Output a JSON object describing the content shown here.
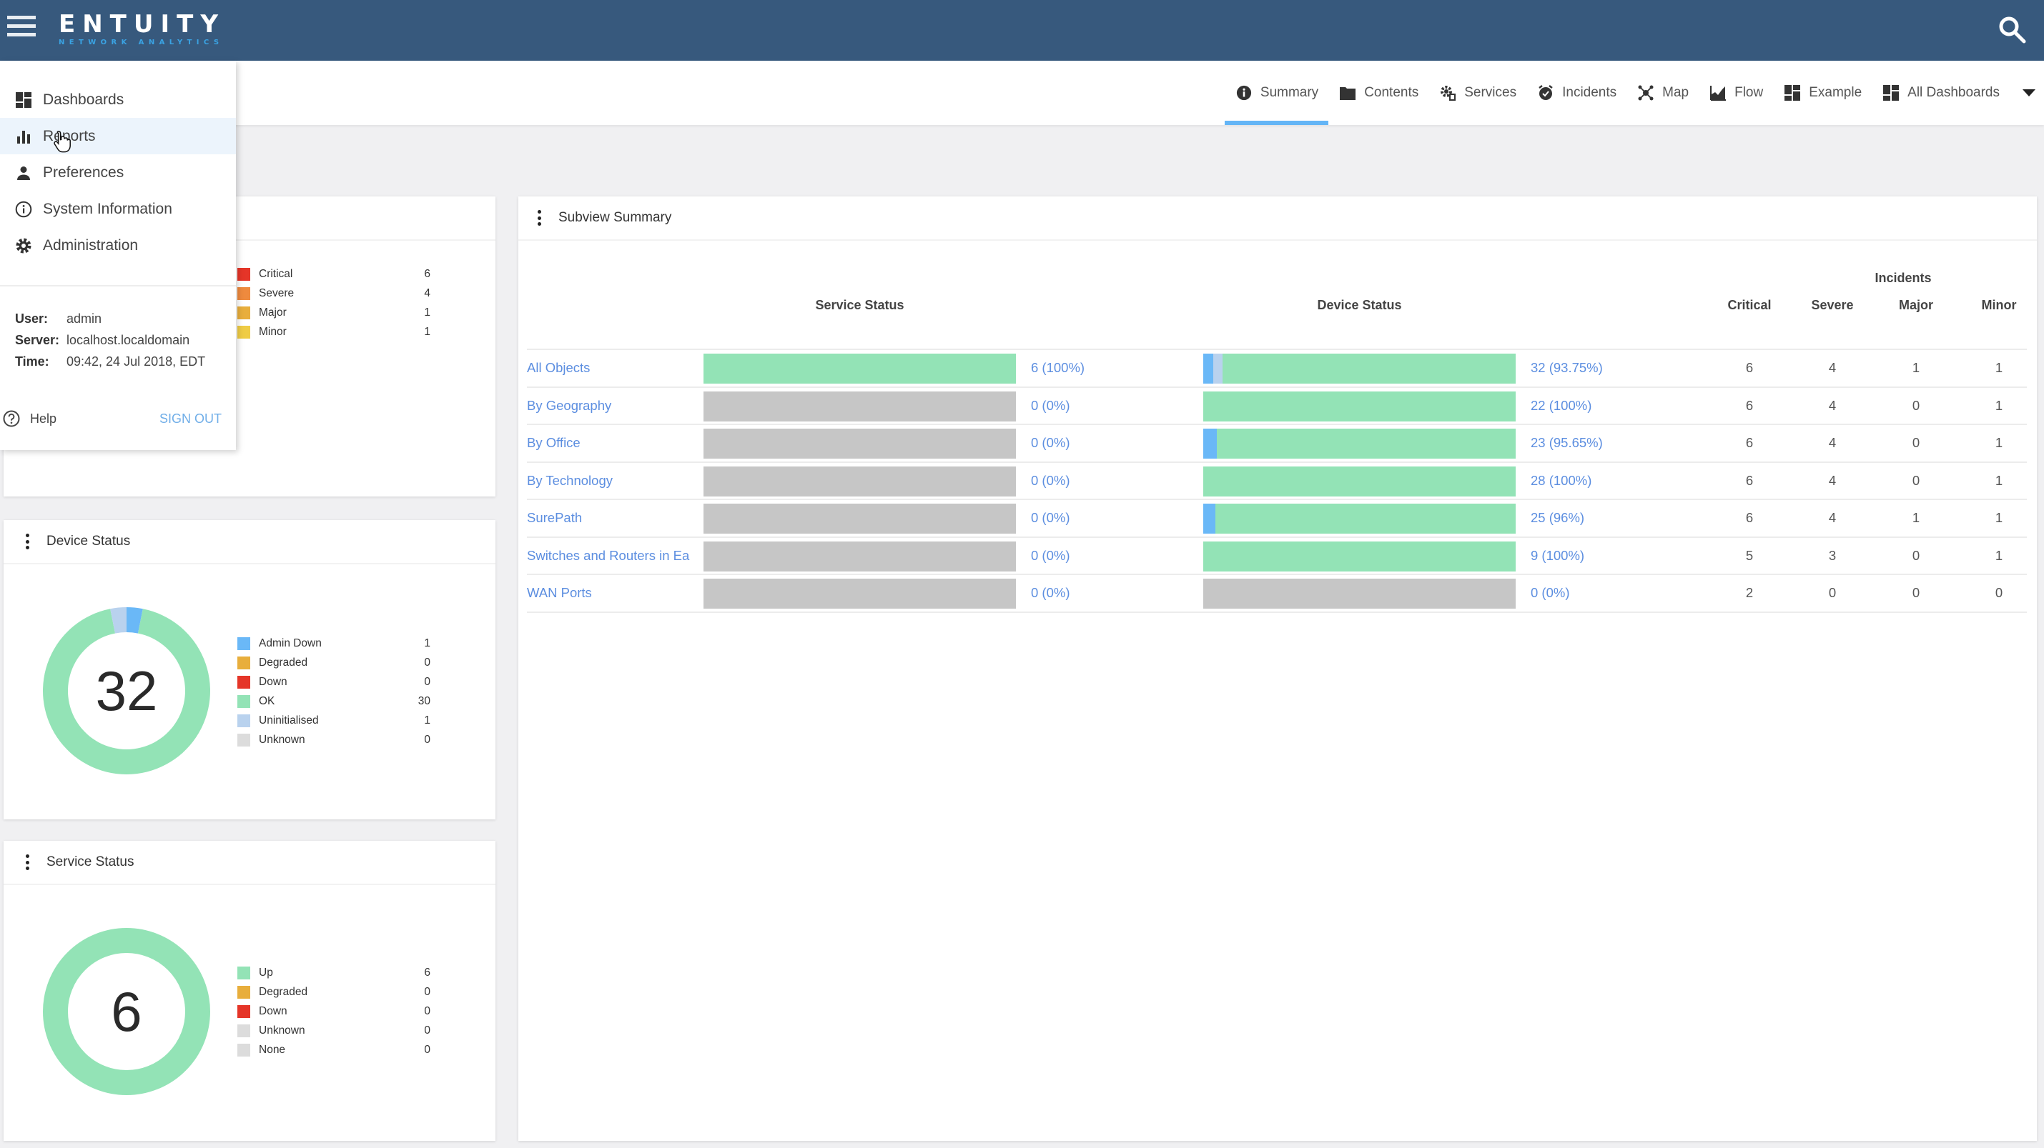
{
  "app": {
    "brand": "ENTUITY",
    "brand_sub": "NETWORK ANALYTICS",
    "header_color": "#37597d",
    "accent": "#64b5f6"
  },
  "tabs": [
    {
      "label": "Summary",
      "icon": "info-circle-icon",
      "active": true
    },
    {
      "label": "Contents",
      "icon": "folder-icon",
      "active": false
    },
    {
      "label": "Services",
      "icon": "services-gear-icon",
      "active": false
    },
    {
      "label": "Incidents",
      "icon": "alarm-clock-icon",
      "active": false
    },
    {
      "label": "Map",
      "icon": "network-map-icon",
      "active": false
    },
    {
      "label": "Flow",
      "icon": "area-chart-icon",
      "active": false
    },
    {
      "label": "Example",
      "icon": "dashboard-icon",
      "active": false
    },
    {
      "label": "All Dashboards",
      "icon": "dashboard-icon",
      "active": false
    }
  ],
  "menu": {
    "items": [
      {
        "label": "Dashboards",
        "icon": "dashboard-icon"
      },
      {
        "label": "Reports",
        "icon": "bar-chart-icon",
        "hovered": true
      },
      {
        "label": "Preferences",
        "icon": "person-icon"
      },
      {
        "label": "System Information",
        "icon": "info-outline-icon"
      },
      {
        "label": "Administration",
        "icon": "gear-icon"
      }
    ],
    "info": {
      "user_label": "User:",
      "user": "admin",
      "server_label": "Server:",
      "server": "localhost.localdomain",
      "time_label": "Time:",
      "time": "09:42, 24 Jul 2018, EDT"
    },
    "help_label": "Help",
    "signout_label": "SIGN OUT"
  },
  "incidents_panel": {
    "legend": [
      {
        "label": "Critical",
        "value": 6,
        "color": "#e53528"
      },
      {
        "label": "Severe",
        "value": 4,
        "color": "#ee8a3e"
      },
      {
        "label": "Major",
        "value": 1,
        "color": "#e8ae3c"
      },
      {
        "label": "Minor",
        "value": 1,
        "color": "#efcc45"
      }
    ]
  },
  "device_panel": {
    "title": "Device Status",
    "total": "32",
    "legend": [
      {
        "label": "Admin Down",
        "value": 1,
        "color": "#6ab8f7"
      },
      {
        "label": "Degraded",
        "value": 0,
        "color": "#e8ae3c"
      },
      {
        "label": "Down",
        "value": 0,
        "color": "#e53528"
      },
      {
        "label": "OK",
        "value": 30,
        "color": "#93e3b6"
      },
      {
        "label": "Uninitialised",
        "value": 1,
        "color": "#b9d2ee"
      },
      {
        "label": "Unknown",
        "value": 0,
        "color": "#dcdcdc"
      }
    ]
  },
  "service_panel": {
    "title": "Service Status",
    "total": "6",
    "legend": [
      {
        "label": "Up",
        "value": 6,
        "color": "#93e3b6"
      },
      {
        "label": "Degraded",
        "value": 0,
        "color": "#e8ae3c"
      },
      {
        "label": "Down",
        "value": 0,
        "color": "#e53528"
      },
      {
        "label": "Unknown",
        "value": 0,
        "color": "#dcdcdc"
      },
      {
        "label": "None",
        "value": 0,
        "color": "#dcdcdc"
      }
    ]
  },
  "subview": {
    "title": "Subview Summary",
    "headers": {
      "service_status": "Service Status",
      "device_status": "Device Status",
      "incidents": "Incidents",
      "critical": "Critical",
      "severe": "Severe",
      "major": "Major",
      "minor": "Minor"
    },
    "empty_color": "#c6c6c6",
    "rows": [
      {
        "name": "All Objects",
        "service": {
          "segments": [
            {
              "status": "Up",
              "count": 6,
              "color": "#93e3b6"
            }
          ],
          "text": "6 (100%)"
        },
        "device": {
          "segments": [
            {
              "status": "Admin Down",
              "count": 1,
              "color": "#6ab8f7"
            },
            {
              "status": "Uninitialised",
              "count": 1,
              "color": "#b9d2ee"
            },
            {
              "status": "OK",
              "count": 30,
              "color": "#93e3b6"
            }
          ],
          "text": "32 (93.75%)"
        },
        "critical": "6",
        "severe": "4",
        "major": "1",
        "minor": "1"
      },
      {
        "name": "By Geography",
        "service": {
          "segments": [],
          "text": "0 (0%)"
        },
        "device": {
          "segments": [
            {
              "status": "OK",
              "count": 22,
              "color": "#93e3b6"
            }
          ],
          "text": "22 (100%)"
        },
        "critical": "6",
        "severe": "4",
        "major": "0",
        "minor": "1"
      },
      {
        "name": "By Office",
        "service": {
          "segments": [],
          "text": "0 (0%)"
        },
        "device": {
          "segments": [
            {
              "status": "Admin Down",
              "count": 1,
              "color": "#6ab8f7"
            },
            {
              "status": "OK",
              "count": 22,
              "color": "#93e3b6"
            }
          ],
          "text": "23 (95.65%)"
        },
        "critical": "6",
        "severe": "4",
        "major": "0",
        "minor": "1"
      },
      {
        "name": "By Technology",
        "service": {
          "segments": [],
          "text": "0 (0%)"
        },
        "device": {
          "segments": [
            {
              "status": "OK",
              "count": 28,
              "color": "#93e3b6"
            }
          ],
          "text": "28 (100%)"
        },
        "critical": "6",
        "severe": "4",
        "major": "0",
        "minor": "1"
      },
      {
        "name": "SurePath",
        "service": {
          "segments": [],
          "text": "0 (0%)"
        },
        "device": {
          "segments": [
            {
              "status": "Admin Down",
              "count": 1,
              "color": "#6ab8f7"
            },
            {
              "status": "OK",
              "count": 24,
              "color": "#93e3b6"
            }
          ],
          "text": "25 (96%)"
        },
        "critical": "6",
        "severe": "4",
        "major": "1",
        "minor": "1"
      },
      {
        "name": "Switches and Routers in Ea",
        "service": {
          "segments": [],
          "text": "0 (0%)"
        },
        "device": {
          "segments": [
            {
              "status": "OK",
              "count": 9,
              "color": "#93e3b6"
            }
          ],
          "text": "9 (100%)"
        },
        "critical": "5",
        "severe": "3",
        "major": "0",
        "minor": "1"
      },
      {
        "name": "WAN Ports",
        "service": {
          "segments": [],
          "text": "0 (0%)"
        },
        "device": {
          "segments": [],
          "text": "0 (0%)"
        },
        "critical": "2",
        "severe": "0",
        "major": "0",
        "minor": "0"
      }
    ]
  }
}
